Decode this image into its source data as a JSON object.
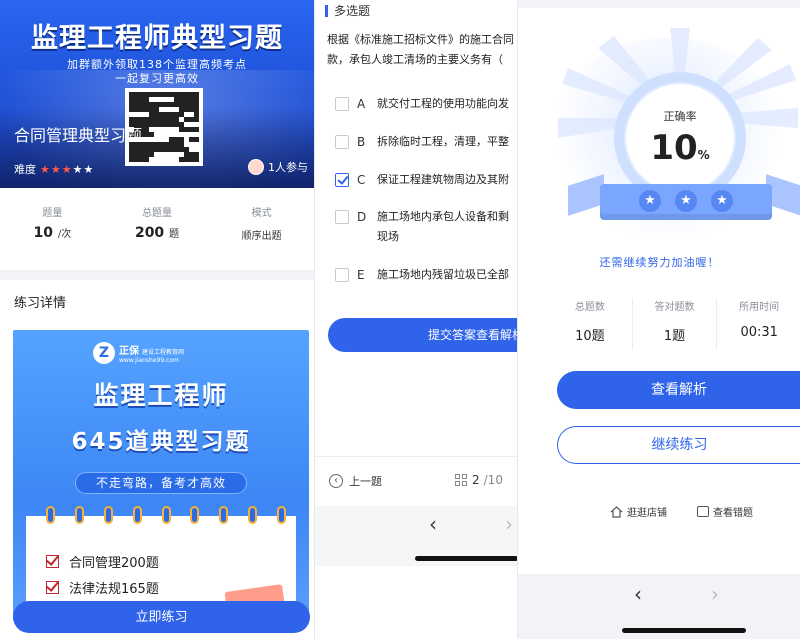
{
  "course": {
    "banner_title": "监理工程师典型习题",
    "banner_sub1": "加群额外领取138个监理高频考点",
    "banner_sub2": "一起复习更高效",
    "name": "合同管理典型习题",
    "difficulty_label": "难度",
    "difficulty_stars": 3,
    "difficulty_max": 5,
    "participants": "1人参与",
    "stats": [
      {
        "label": "题量",
        "value": "10",
        "unit": "/次"
      },
      {
        "label": "总题量",
        "value": "200",
        "unit": "题"
      },
      {
        "label": "模式",
        "value": "顺序出题"
      }
    ],
    "detail_title": "练习详情",
    "poster": {
      "logo_mark": "Z",
      "logo_name": "正保",
      "logo_sub": "建设工程教育网",
      "logo_url": "www.jianshe99.com",
      "title1": "监理工程师",
      "title2": "645道典型习题",
      "pill": "不走弯路，备考才高效",
      "items": [
        "合同管理200题",
        "法律法规165题"
      ]
    },
    "start_button": "立即练习"
  },
  "quiz": {
    "type": "多选题",
    "stem_line1": "根据《标准施工招标文件》的施工合同",
    "stem_line2": "款，承包人竣工清场的主要义务有（",
    "options": [
      {
        "letter": "A",
        "text": "就交付工程的使用功能向发",
        "checked": false
      },
      {
        "letter": "B",
        "text": "拆除临时工程，清理，平整",
        "checked": false
      },
      {
        "letter": "C",
        "text": "保证工程建筑物周边及其附",
        "checked": true
      },
      {
        "letter": "D",
        "text": "施工场地内承包人设备和剩",
        "text2": "现场",
        "checked": false
      },
      {
        "letter": "E",
        "text": "施工场地内残留垃圾已全部",
        "checked": false
      }
    ],
    "submit": "提交答案查看解析",
    "prev": "上一题",
    "page_current": "2",
    "page_total": "/10"
  },
  "result": {
    "accuracy_label": "正确率",
    "accuracy_value": "10",
    "accuracy_unit": "%",
    "encourage": "还需继续努力加油喔！",
    "stats": [
      {
        "label": "总题数",
        "value": "10题"
      },
      {
        "label": "答对题数",
        "value": "1题"
      },
      {
        "label": "所用时间",
        "value": "00:31"
      }
    ],
    "view_analysis": "查看解析",
    "continue": "继续练习",
    "link_store": "逛逛店铺",
    "link_wrong": "查看错题"
  },
  "colors": {
    "accent": "#2f63ea",
    "star_on": "#ff5a4a",
    "check_red": "#c0282d"
  }
}
